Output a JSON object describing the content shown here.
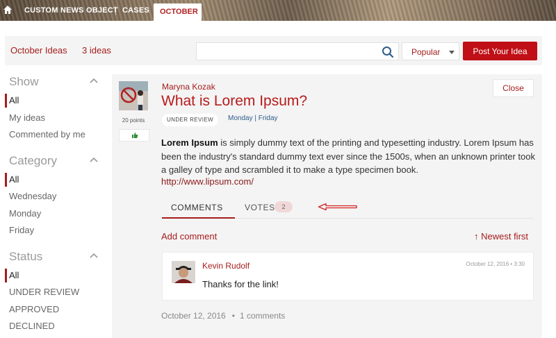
{
  "nav": {
    "items": [
      "CUSTOM NEWS OBJECT",
      "CASES"
    ],
    "active_tab": "OCTOBER",
    "home_icon": "home-icon"
  },
  "header": {
    "title": "October Ideas",
    "count": "3 ideas",
    "search_placeholder": "",
    "sort_label": "Popular",
    "post_button": "Post Your Idea"
  },
  "sidebar": {
    "show": {
      "title": "Show",
      "items": [
        "All",
        "My ideas",
        "Commented by me"
      ],
      "active": "All"
    },
    "category": {
      "title": "Category",
      "items": [
        "All",
        "Wednesday",
        "Monday",
        "Friday"
      ],
      "active": "All"
    },
    "status": {
      "title": "Status",
      "items": [
        "All",
        "UNDER REVIEW",
        "APPROVED",
        "DECLINED"
      ],
      "active": "All"
    }
  },
  "idea": {
    "author": "Maryna Kozak",
    "title": "What is Lorem Ipsum?",
    "status": "UNDER REVIEW",
    "categories": "Monday | Friday",
    "points": "20 points",
    "close_label": "Close",
    "body_bold": "Lorem Ipsum",
    "body_rest": " is simply dummy text of the printing and typesetting industry. Lorem Ipsum has been the industry's standard dummy text ever since the 1500s, when an unknown printer took a galley of type and scrambled it to make a type specimen book.",
    "link": "http://www.lipsum.com/",
    "tabs": {
      "comments": "COMMENTS",
      "votes": "VOTES",
      "votes_count": "2"
    },
    "add_comment": "Add comment",
    "sort_comments": "↑ Newest first",
    "date": "October 12, 2016",
    "comment_count": "1 comments"
  },
  "comment": {
    "author": "Kevin Rudolf",
    "date": "October 12, 2016 • 3:30",
    "text": "Thanks for the link!"
  },
  "colors": {
    "accent": "#a51c1c",
    "post_button": "#c00f16",
    "panel": "#f4f4f4"
  }
}
